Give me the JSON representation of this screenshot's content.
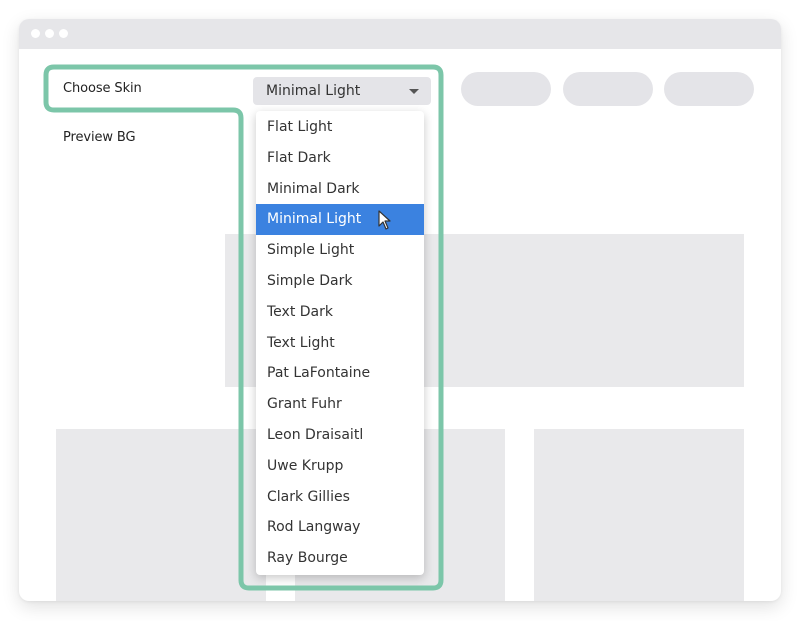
{
  "window": {
    "titlebar_dots": [
      "window-dot-1",
      "window-dot-2",
      "window-dot-3"
    ]
  },
  "settings": {
    "choose_skin_label": "Choose Skin",
    "preview_bg_label": "Preview BG",
    "skin_select": {
      "value": "Minimal Light",
      "icon": "chevron-down-icon"
    }
  },
  "skin_menu": {
    "selected": "Minimal Light",
    "options": [
      "Flat Light",
      "Flat Dark",
      "Minimal Dark",
      "Minimal Light",
      "Simple Light",
      "Simple Dark",
      "Text Dark",
      "Text Light",
      "Pat LaFontaine",
      "Grant Fuhr",
      "Leon Draisaitl",
      "Uwe Krupp",
      "Clark Gillies",
      "Rod Langway",
      "Ray Bourge"
    ]
  },
  "colors": {
    "highlight": "#7cc6a9",
    "selected_item": "#3b82e0",
    "placeholder": "#e9e9eb",
    "titlebar": "#e6e6e9"
  },
  "cursor": {
    "icon": "mouse-pointer-icon"
  }
}
